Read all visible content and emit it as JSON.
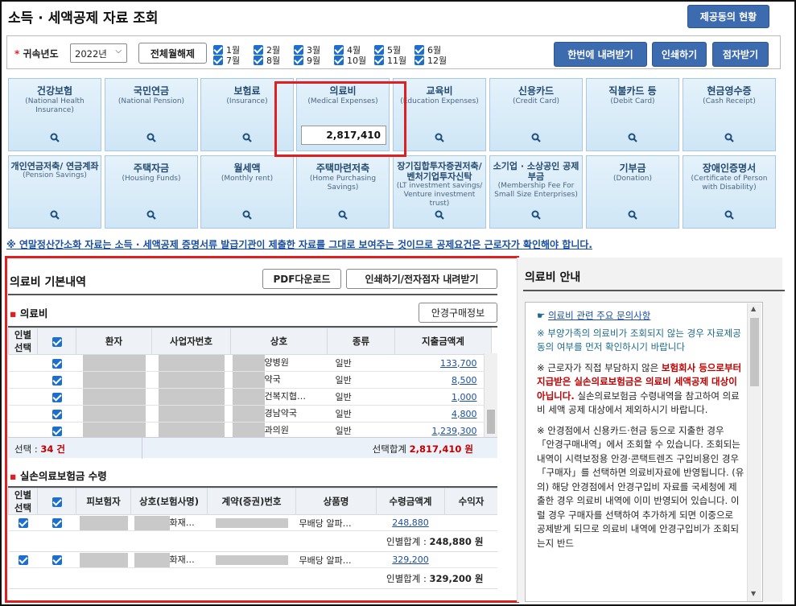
{
  "title": "소득 · 세액공제 자료 조회",
  "header_button": "제공동의 현황",
  "filter": {
    "year_label": "귀속년도",
    "year_value": "2022년",
    "toggle_button": "전체월해제",
    "months": [
      "1월",
      "2월",
      "3월",
      "4월",
      "5월",
      "6월",
      "7월",
      "8월",
      "9월",
      "10월",
      "11월",
      "12월"
    ],
    "download_all": "한번에 내려받기",
    "print": "인쇄하기",
    "pick": "점자받기"
  },
  "cards": [
    {
      "ko": "건강보험",
      "en": "(National Health Insurance)"
    },
    {
      "ko": "국민연금",
      "en": "(National Pension)"
    },
    {
      "ko": "보험료",
      "en": "(Insurance)"
    },
    {
      "ko": "의료비",
      "en": "(Medical Expenses)",
      "value": "2,817,410"
    },
    {
      "ko": "교육비",
      "en": "(Education Expenses)"
    },
    {
      "ko": "신용카드",
      "en": "(Credit Card)"
    },
    {
      "ko": "직불카드 등",
      "en": "(Debit Card)"
    },
    {
      "ko": "현금영수증",
      "en": "(Cash Receipt)"
    },
    {
      "ko": "개인연금저축/ 연금계좌",
      "en": "(Pension Savings)"
    },
    {
      "ko": "주택자금",
      "en": "(Housing Funds)"
    },
    {
      "ko": "월세액",
      "en": "(Monthly rent)"
    },
    {
      "ko": "주택마련저축",
      "en": "(Home Purchasing Savings)"
    },
    {
      "ko": "장기집합투자증권저축/ 벤처기업투자신탁",
      "en": "(LT investment savings/ Venture investment trust)"
    },
    {
      "ko": "소기업 · 소상공인 공제부금",
      "en": "(Membership Fee For Small Size Enterprises)"
    },
    {
      "ko": "기부금",
      "en": "(Donation)"
    },
    {
      "ko": "장애인증명서",
      "en": "(Certificate of Person with Disability)"
    }
  ],
  "notice": "※ 연말정산간소화 자료는 소득 · 세액공제 증명서류 발급기관이 제출한 자료를 그대로 보여주는 것이므로 공제요건은 근로자가 확인해야 합니다.",
  "detail": {
    "heading": "의료비 기본내역",
    "pdf_button": "PDF다운로드",
    "print_button": "인쇄하기/전자점자 내려받기",
    "section1": "의료비",
    "glasses_button": "안경구매정보",
    "columns1": [
      "인별 선택",
      "",
      "환자",
      "사업자번호",
      "상호",
      "종류",
      "지출금액계"
    ],
    "rows1": [
      {
        "name": "양병원",
        "kind": "일반",
        "amount": "133,700"
      },
      {
        "name": "약국",
        "kind": "일반",
        "amount": "8,500"
      },
      {
        "name": "건복지협…",
        "kind": "일반",
        "amount": "1,000"
      },
      {
        "name": "경남약국",
        "kind": "일반",
        "amount": "4,800"
      },
      {
        "name": "과의원",
        "kind": "일반",
        "amount": "1,239,300"
      }
    ],
    "selected_label": "선택 : ",
    "selected_count": "34 건",
    "selected_sum_label": "선택합계 ",
    "selected_sum": "2,817,410 원",
    "section2": "실손의료보험금 수령",
    "columns2": [
      "인별 선택",
      "",
      "피보험자",
      "상호(보험사명)",
      "계약(증권)번호",
      "상품명",
      "수령금액계",
      "수익자"
    ],
    "rows2": [
      {
        "company": "화재…",
        "product": "무배당 알파…",
        "amount": "248,880",
        "subtotal_label": "인별합계 : ",
        "subtotal": "248,880 원"
      },
      {
        "company": "화재…",
        "product": "무배당 알파…",
        "amount": "329,200",
        "subtotal_label": "인별합계 : ",
        "subtotal": "329,200 원"
      }
    ]
  },
  "guide": {
    "heading": "의료비 안내",
    "link": "의료비 관련 주요 문의사항",
    "p1": "※ 부양가족의 의료비가 조회되지 않는 경우 자료제공동의 여부를 먼저 확인하시기 바랍니다",
    "p2a": "※ 근로자가 직접 부담하지 않은 ",
    "p2b": "보험회사 등으로부터 지급받은 실손의료보험금은 의료비 세액공제 대상이 아닙니다.",
    "p2c": " 실손의료보험금 수령내역을 참고하여 의료비 세액 공제 대상에서 제외하시기 바랍니다.",
    "p3": "※ 안경점에서 신용카드·현금 등으로 지출한 경우 「안경구매내역」에서 조회할 수 있습니다. 조회되는 내역이 시력보정용 안경·콘택트렌즈 구입비용인 경우 「구매자」를 선택하면 의료비자료에 반영됩니다. (유의) 해당 안경점에서 안경구입비 자료를 국세청에 제출한 경우 의료비 내역에 이미 반영되어 있습니다. 이럴 경우 구매자를 선택하여 추가하게 되면 이중으로 공제받게 되므로 의료비 내역에 안경구입비가 조회되는지 반드"
  },
  "colors": {
    "highlight": "#e02020",
    "accent": "#3d6bb0",
    "red": "#c00000"
  }
}
